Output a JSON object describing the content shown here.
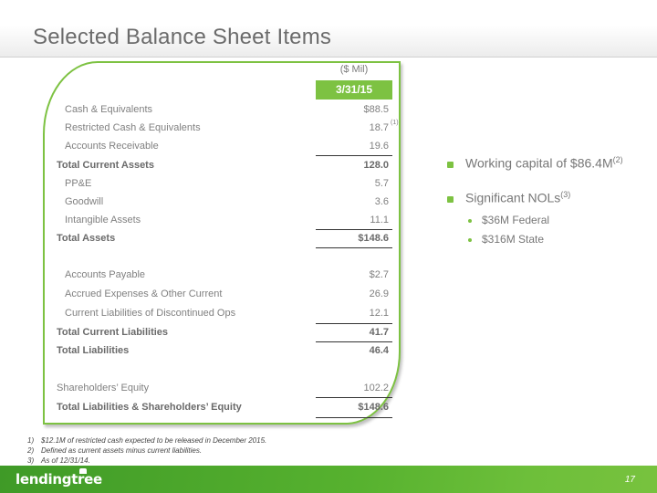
{
  "header": {
    "title": "Selected Balance Sheet Items"
  },
  "table": {
    "unit_label": "($ Mil)",
    "column_header": "3/31/15",
    "rows": [
      {
        "label": "Cash & Equivalents",
        "value": "$88.5",
        "type": "item"
      },
      {
        "label": "Restricted Cash & Equivalents",
        "value": "18.7",
        "type": "item",
        "footnote_ref": "(1)"
      },
      {
        "label": "Accounts Receivable",
        "value": "19.6",
        "type": "item"
      },
      {
        "label": "Total Current Assets",
        "value": "128.0",
        "type": "total"
      },
      {
        "label": "PP&E",
        "value": "5.7",
        "type": "item"
      },
      {
        "label": "Goodwill",
        "value": "3.6",
        "type": "item"
      },
      {
        "label": "Intangible Assets",
        "value": "11.1",
        "type": "item"
      },
      {
        "label": "Total Assets",
        "value": "$148.6",
        "type": "total"
      },
      {
        "label": "Accounts Payable",
        "value": "$2.7",
        "type": "item"
      },
      {
        "label": "Accrued Expenses & Other Current",
        "value": "26.9",
        "type": "item"
      },
      {
        "label": "Current Liabilities of Discontinued Ops",
        "value": "12.1",
        "type": "item"
      },
      {
        "label": "Total Current Liabilities",
        "value": "41.7",
        "type": "total"
      },
      {
        "label": "Total Liabilities",
        "value": "46.4",
        "type": "total"
      },
      {
        "label": "Shareholders’ Equity",
        "value": "102.2",
        "type": "item-flush"
      },
      {
        "label": "Total Liabilities & Shareholders’ Equity",
        "value": "$148.6",
        "type": "total"
      }
    ]
  },
  "highlights": {
    "bullets": [
      {
        "text": "Working capital of  $86.4M",
        "sup": "(2)"
      },
      {
        "text": "Significant NOLs",
        "sup": "(3)",
        "sub_bullets": [
          "$36M Federal",
          "$316M State"
        ]
      }
    ]
  },
  "footnotes": [
    {
      "num": "1)",
      "text": "$12.1M of restricted cash expected to be released in December 2015."
    },
    {
      "num": "2)",
      "text": "Defined as current assets minus current liabilities."
    },
    {
      "num": "3)",
      "text": "As of 12/31/14."
    }
  ],
  "footer": {
    "logo": "lendingtree",
    "page_number": "17"
  },
  "colors": {
    "accent": "#7dc242",
    "title_text": "#6b6b6b",
    "body_text": "#808080"
  }
}
